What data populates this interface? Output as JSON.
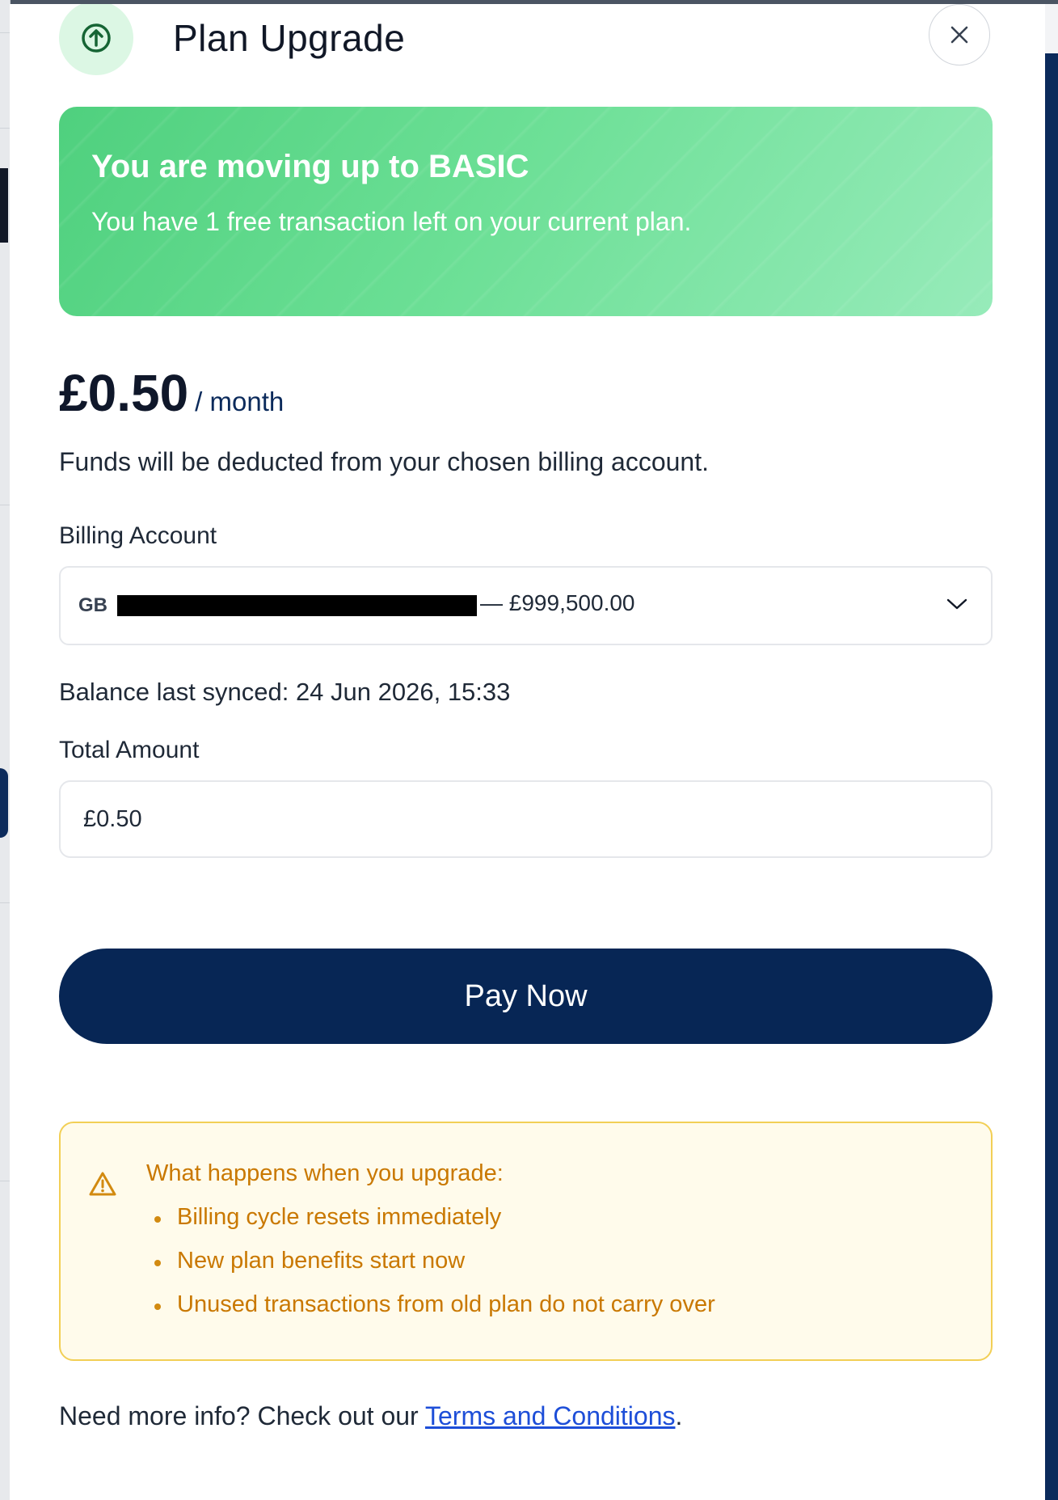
{
  "header": {
    "title": "Plan Upgrade",
    "icon": "arrow-up-circle-icon",
    "close_icon": "close-icon"
  },
  "hero": {
    "title": "You are moving up to BASIC",
    "subtitle": "You have 1 free transaction left on your current plan."
  },
  "pricing": {
    "amount": "£0.50",
    "period": "/ month",
    "note": "Funds will be deducted from your chosen billing account."
  },
  "billing": {
    "label": "Billing Account",
    "prefix": "GB",
    "value": "— £999,500.00",
    "chevron_icon": "chevron-down-icon",
    "synced": "Balance last synced: 24 Jun 2026, 15:33"
  },
  "total": {
    "label": "Total Amount",
    "value": "£0.50"
  },
  "actions": {
    "pay_label": "Pay Now"
  },
  "notice": {
    "icon": "warning-icon",
    "title": "What happens when you upgrade:",
    "items": [
      "Billing cycle resets immediately",
      "New plan benefits start now",
      "Unused transactions from old plan do not carry over"
    ]
  },
  "footer": {
    "text": "Need more info? Check out our ",
    "link": "Terms and Conditions",
    "suffix": "."
  },
  "colors": {
    "accent_green": "#4fd07e",
    "primary_navy": "#072655",
    "warning_text": "#c97800",
    "warning_border": "#f2cf55",
    "link": "#1d4ed8"
  }
}
